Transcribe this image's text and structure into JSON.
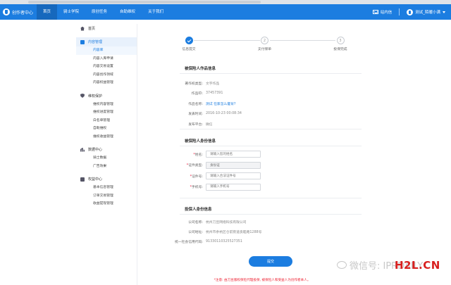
{
  "topnav": {
    "brand": "创作者中心",
    "items": [
      "首页",
      "骑士学院",
      "原创任务",
      "自助维权",
      "关于我们"
    ],
    "active_index": 0,
    "messages_label": "站内信",
    "username": "测试_陌暖小满",
    "accent": "#1c7de0"
  },
  "sidebar": {
    "groups": [
      {
        "label": "首页",
        "icon": "home-icon",
        "items": []
      },
      {
        "label": "内容管理",
        "icon": "document-icon",
        "active": true,
        "items": [
          "内容库",
          "内容入库申请",
          "内容交易设置",
          "内容创作领域",
          "内容权益管理"
        ],
        "active_item": 0
      },
      {
        "label": "维权保护",
        "icon": "shield-icon",
        "items": [
          "维权内容管理",
          "维权进度管理",
          "白名单管理",
          "自助维权",
          "维权收益管理"
        ]
      },
      {
        "label": "数据中心",
        "icon": "chart-icon",
        "items": [
          "骑士数据",
          "广告效果"
        ]
      },
      {
        "label": "权益中心",
        "icon": "profile-icon",
        "items": [
          "基本信息管理",
          "订单交易管理",
          "收益提现管理"
        ]
      }
    ]
  },
  "steps": [
    {
      "num": "1",
      "label": "信息提交",
      "done": true
    },
    {
      "num": "2",
      "label": "支付保单",
      "done": false
    },
    {
      "num": "3",
      "label": "投保完成",
      "done": false
    }
  ],
  "work_info": {
    "title": "被保险人作品信息",
    "rows": [
      {
        "label": "著作权类型:",
        "value": "文字作品"
      },
      {
        "label": "作品ID:",
        "value": "37457391"
      },
      {
        "label": "作品名称:",
        "value": "测试 在家怎么搓背?",
        "link": true
      },
      {
        "label": "发表时间:",
        "value": "2016-10-23 00:08:34"
      },
      {
        "label": "发布平台:",
        "value": "微信"
      }
    ]
  },
  "identity_info": {
    "title": "被保险人身份信息",
    "fields": [
      {
        "label": "姓名:",
        "placeholder": "请输入您的姓名",
        "type": "input"
      },
      {
        "label": "证件类型:",
        "value": "身份证",
        "type": "select"
      },
      {
        "label": "证件号:",
        "placeholder": "请输入合法证件号",
        "type": "input"
      },
      {
        "label": "手机号:",
        "placeholder": "请输入手机号",
        "type": "input"
      }
    ]
  },
  "applicant_info": {
    "title": "投保人身份信息",
    "rows": [
      {
        "label": "公司名称:",
        "value": "杭州刀豆网络科技有限公司"
      },
      {
        "label": "公司地址:",
        "value": "杭州市余杭区仓前街道良睦路1288号"
      },
      {
        "label": "统一社会信用代码:",
        "value": "91330110325527351"
      }
    ]
  },
  "submit_label": "提交",
  "note": "*注意: 由刀豆版权保险代理投保, 被保险人和受益人为创作者本人。",
  "watermark": {
    "text": "微信号: IPRDAILY",
    "site": "H2L.CN"
  }
}
